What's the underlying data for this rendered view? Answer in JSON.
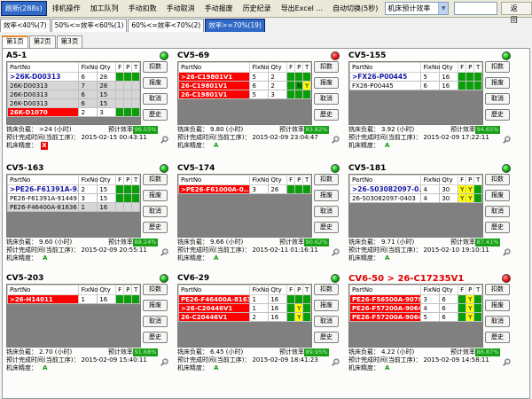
{
  "toolbar": {
    "refresh": "刷新(288s)",
    "items": [
      "排机操作",
      "加工队列",
      "手动扣数",
      "手动取消",
      "手动报废",
      "历史纪录",
      "导出Excel ...",
      "自动切换(5秒)"
    ],
    "combo_value": "机床预计效率",
    "back": "返回"
  },
  "eff_tabs": [
    "效率<40%(7)",
    "50%<=效率<60%(1)",
    "60%<=效率<70%(2)",
    "效率>=70%(19)"
  ],
  "page_tabs": [
    "第1页",
    "第2页",
    "第3页"
  ],
  "labels": {
    "load": "铣床负载：",
    "efficiency": "预计效率：",
    "finish": "预计完成时间(当前工序)：",
    "precision": "机床精度：",
    "partno": "PartNo",
    "fixno": "FixNo",
    "qty": "Qty",
    "f": "F",
    "p": "P",
    "t": "T",
    "btn_deduct": "扣数",
    "btn_scrap": "报废",
    "btn_cancel": "取消",
    "btn_history": "歷史"
  },
  "panels": [
    {
      "name": "A5-1",
      "status": "green",
      "title_red": false,
      "rows": [
        {
          "pn": ">26K-D00313",
          "fix": "6",
          "qty": "28",
          "f": "G",
          "p": "G",
          "t": "G",
          "style": "sel"
        },
        {
          "pn": "26K-D00313",
          "fix": "7",
          "qty": "28",
          "f": "G",
          "p": "G",
          "t": "G",
          "style": "gray"
        },
        {
          "pn": "26K-D00313",
          "fix": "6",
          "qty": "15",
          "f": "G",
          "p": "G",
          "t": "G",
          "style": "gray"
        },
        {
          "pn": "26K-D00313",
          "fix": "6",
          "qty": "15",
          "f": "G",
          "p": "G",
          "t": "G",
          "style": "gray"
        },
        {
          "pn": "26K-D1070",
          "fix": "2",
          "qty": "3",
          "f": "G",
          "p": "G",
          "t": "G",
          "style": "red"
        }
      ],
      "load": ">24 (小时)",
      "eff": "96.55%",
      "finish": "2015-02-15 00:43:11",
      "precision": "X",
      "precision_bad": true
    },
    {
      "name": "CV5-69",
      "status": "red",
      "title_red": false,
      "rows": [
        {
          "pn": ">26-C19801V1",
          "fix": "5",
          "qty": "2",
          "f": "G",
          "p": "G",
          "t": "G",
          "style": "red"
        },
        {
          "pn": "26-C19801V1",
          "fix": "6",
          "qty": "2",
          "f": "G",
          "p": "N",
          "t": "Y",
          "style": "red"
        },
        {
          "pn": "26-C19801V1",
          "fix": "5",
          "qty": "3",
          "f": "G",
          "p": "G",
          "t": "G",
          "style": "red"
        }
      ],
      "load": "9.80 (小时)",
      "eff": "83.82%",
      "finish": "2015-02-09 23:04:47",
      "precision": "A",
      "precision_bad": false
    },
    {
      "name": "CV5-155",
      "status": "green",
      "title_red": false,
      "rows": [
        {
          "pn": ">FX26-P00445",
          "fix": "5",
          "qty": "16",
          "f": "G",
          "p": "G",
          "t": "G",
          "style": "sel"
        },
        {
          "pn": "FX26-P00445",
          "fix": "6",
          "qty": "16",
          "f": "G",
          "p": "G",
          "t": "G",
          "style": ""
        }
      ],
      "load": "3.92 (小时)",
      "eff": "94.65%",
      "finish": "2015-02-09 17:22:11",
      "precision": "A",
      "precision_bad": false
    },
    {
      "name": "CV5-163",
      "status": "green",
      "title_red": false,
      "rows": [
        {
          "pn": ">PE26-F61391A-9...",
          "fix": "2",
          "qty": "15",
          "f": "G",
          "p": "G",
          "t": "G",
          "style": "sel"
        },
        {
          "pn": "PE26-F61391A-91449",
          "fix": "3",
          "qty": "15",
          "f": "G",
          "p": "G",
          "t": "G",
          "style": ""
        },
        {
          "pn": "PE26-F46400A-81636",
          "fix": "1",
          "qty": "16",
          "f": "G",
          "p": "G",
          "t": "G",
          "style": "gray"
        }
      ],
      "load": "9.60 (小时)",
      "eff": "88.24%",
      "finish": "2015-02-09 20:55:11",
      "precision": "A",
      "precision_bad": false
    },
    {
      "name": "CV5-174",
      "status": "green",
      "title_red": false,
      "rows": [
        {
          "pn": ">PE26-F61000A-0...",
          "fix": "3",
          "qty": "26",
          "f": "G",
          "p": "G",
          "t": "G",
          "style": "red"
        }
      ],
      "load": "9.66 (小时)",
      "eff": "90.62%",
      "finish": "2015-02-11 01:16:11",
      "precision": "A",
      "precision_bad": false
    },
    {
      "name": "CV5-181",
      "status": "green",
      "title_red": false,
      "rows": [
        {
          "pn": ">26-S03082097-0...",
          "fix": "4",
          "qty": "30",
          "f": "Y",
          "p": "Y",
          "t": "G",
          "style": "sel"
        },
        {
          "pn": "26-S03082097-0403",
          "fix": "4",
          "qty": "30",
          "f": "Y",
          "p": "Y",
          "t": "G",
          "style": ""
        }
      ],
      "load": "9.71 (小时)",
      "eff": "87.41%",
      "finish": "2015-02-10 19:10:11",
      "precision": "A",
      "precision_bad": false
    },
    {
      "name": "CV5-203",
      "status": "green",
      "title_red": false,
      "rows": [
        {
          "pn": ">26-H14011",
          "fix": "1",
          "qty": "16",
          "f": "G",
          "p": "G",
          "t": "G",
          "style": "red"
        }
      ],
      "load": "2.70 (小时)",
      "eff": "91.68%",
      "finish": "2015-02-09 15:40:11",
      "precision": "A",
      "precision_bad": false
    },
    {
      "name": "CV6-29",
      "status": "green",
      "title_red": false,
      "rows": [
        {
          "pn": "PE26-F46400A-8163...",
          "fix": "1",
          "qty": "16",
          "f": "G",
          "p": "G",
          "t": "G",
          "style": "red"
        },
        {
          "pn": ">26-C20446V1",
          "fix": "1",
          "qty": "16",
          "f": "G",
          "p": "Y",
          "t": "G",
          "style": "red"
        },
        {
          "pn": "26-C20446V1",
          "fix": "2",
          "qty": "16",
          "f": "G",
          "p": "Y",
          "t": "G",
          "style": "red"
        }
      ],
      "load": "6.45 (小时)",
      "eff": "89.95%",
      "finish": "2015-02-09 18:41:23",
      "precision": "A",
      "precision_bad": false
    },
    {
      "name": "CV6-50 > 26-C17235V1",
      "status": "red",
      "title_red": true,
      "rows": [
        {
          "pn": "PE26-F56500A-90780",
          "fix": "3",
          "qty": "6",
          "f": "G",
          "p": "Y",
          "t": "G",
          "style": "red"
        },
        {
          "pn": "PE26-F57200A-90648",
          "fix": "4",
          "qty": "6",
          "f": "G",
          "p": "Y",
          "t": "G",
          "style": "red"
        },
        {
          "pn": "PE26-F57200A-90642",
          "fix": "5",
          "qty": "6",
          "f": "G",
          "p": "Y",
          "t": "G",
          "style": "red"
        }
      ],
      "load": "4.22 (小时)",
      "eff": "86.87%",
      "finish": "2015-02-09 14:58:11",
      "precision": "A",
      "precision_bad": false
    }
  ]
}
